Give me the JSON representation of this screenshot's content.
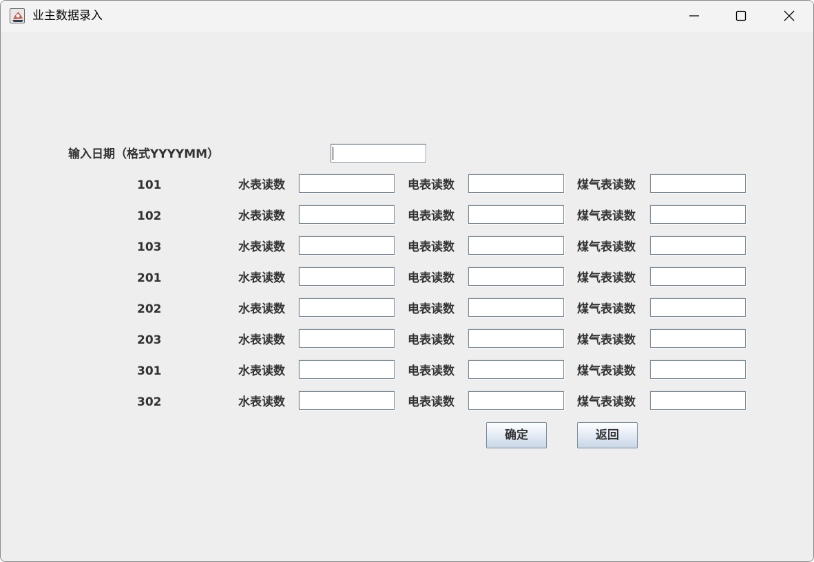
{
  "window": {
    "title": "业主数据录入",
    "controls": [
      "minimize-icon",
      "maximize-icon",
      "close-icon"
    ]
  },
  "date": {
    "label": "输入日期（格式YYYYMM）",
    "value": ""
  },
  "labels": {
    "water": "水表读数",
    "electric": "电表读数",
    "gas": "煤气表读数"
  },
  "rooms": [
    {
      "id": "101",
      "water": "",
      "electric": "",
      "gas": ""
    },
    {
      "id": "102",
      "water": "",
      "electric": "",
      "gas": ""
    },
    {
      "id": "103",
      "water": "",
      "electric": "",
      "gas": ""
    },
    {
      "id": "201",
      "water": "",
      "electric": "",
      "gas": ""
    },
    {
      "id": "202",
      "water": "",
      "electric": "",
      "gas": ""
    },
    {
      "id": "203",
      "water": "",
      "electric": "",
      "gas": ""
    },
    {
      "id": "301",
      "water": "",
      "electric": "",
      "gas": ""
    },
    {
      "id": "302",
      "water": "",
      "electric": "",
      "gas": ""
    }
  ],
  "buttons": {
    "confirm": "确定",
    "back": "返回"
  }
}
